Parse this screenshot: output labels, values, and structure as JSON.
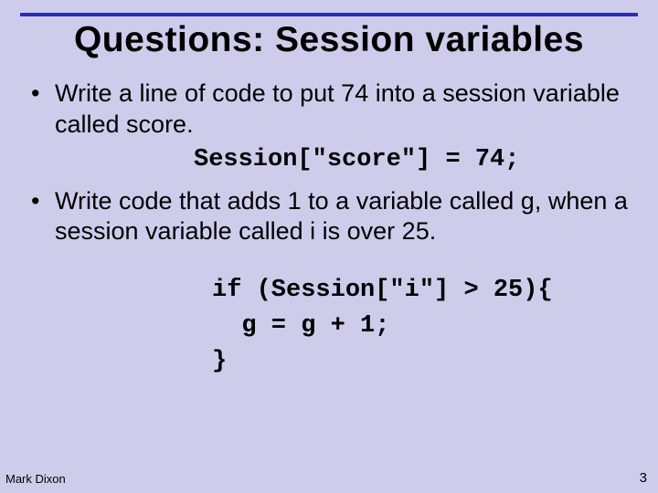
{
  "title": "Questions: Session variables",
  "bullets": [
    {
      "text": "Write a line of code to put 74 into a session variable called score.",
      "code": "Session[\"score\"] = 74;"
    },
    {
      "text": "Write code that\nadds 1 to a variable called g,\nwhen a session variable called i is over 25.",
      "code": "if (Session[\"i\"] > 25){\n  g = g + 1;\n}"
    }
  ],
  "footer": {
    "author": "Mark Dixon",
    "page": "3"
  }
}
